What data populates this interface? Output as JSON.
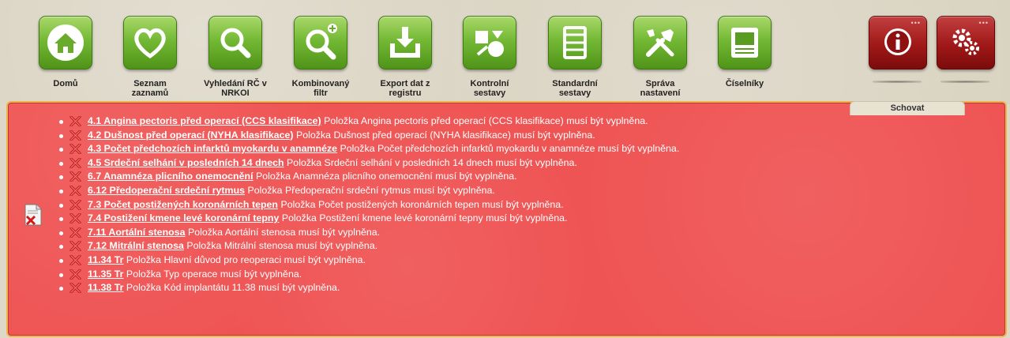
{
  "toolbar": {
    "items": [
      {
        "label": "Domů",
        "icon": "home-icon"
      },
      {
        "label": "Seznam\nzaznamů",
        "icon": "heart-icon"
      },
      {
        "label": "Vyhledání RČ v\nNRKOI",
        "icon": "search-icon"
      },
      {
        "label": "Kombinovaný\nfiltr",
        "icon": "search-plus-icon"
      },
      {
        "label": "Export dat z\nregistru",
        "icon": "download-tray-icon"
      },
      {
        "label": "Kontrolní\nsestavy",
        "icon": "shapes-icon"
      },
      {
        "label": "Standardní\nsestavy",
        "icon": "table-icon"
      },
      {
        "label": "Správa\nnastavení",
        "icon": "tools-icon"
      },
      {
        "label": "Číselníky",
        "icon": "codebook-icon"
      }
    ],
    "right": {
      "info_icon": "info-icon",
      "settings_icon": "gears-icon",
      "dots": "•••"
    }
  },
  "hide_tab": {
    "label": "Schovat"
  },
  "colors": {
    "panel": "#ef5454",
    "tile_green": "#74b935",
    "tile_red": "#a01818"
  },
  "errors": [
    {
      "link": "4.1 Angina pectoris před operací (CCS klasifikace)",
      "message": " Položka Angina pectoris před operací (CCS klasifikace) musí být vyplněna."
    },
    {
      "link": "4.2 Dušnost před operací (NYHA klasifikace)",
      "message": " Položka Dušnost před operací (NYHA klasifikace) musí být vyplněna."
    },
    {
      "link": "4.3 Počet předchozích infarktů myokardu v anamnéze",
      "message": " Položka Počet předchozích infarktů myokardu v anamnéze musí být vyplněna."
    },
    {
      "link": "4.5 Srdeční selhání v posledních 14 dnech",
      "message": " Položka Srdeční selhání v posledních 14 dnech musí být vyplněna."
    },
    {
      "link": "6.7 Anamnéza plicního onemocnění",
      "message": " Položka Anamnéza plicního onemocnění musí být vyplněna."
    },
    {
      "link": "6.12 Předoperační srdeční rytmus",
      "message": " Položka Předoperační srdeční rytmus musí být vyplněna."
    },
    {
      "link": "7.3 Počet postižených koronárních tepen",
      "message": " Položka Počet postižených koronárních tepen musí být vyplněna."
    },
    {
      "link": "7.4 Postižení kmene levé koronární tepny",
      "message": " Položka Postižení kmene levé koronární tepny musí být vyplněna."
    },
    {
      "link": "7.11 Aortální stenosa",
      "message": " Položka Aortální stenosa musí být vyplněna."
    },
    {
      "link": "7.12 Mitrální stenosa",
      "message": " Položka Mitrální stenosa musí být vyplněna."
    },
    {
      "link": "11.34 Tr",
      "message": " Položka Hlavní důvod pro reoperaci musí být vyplněna."
    },
    {
      "link": "11.35 Tr",
      "message": " Položka Typ operace musí být vyplněna."
    },
    {
      "link": "11.38 Tr",
      "message": " Položka Kód implantátu 11.38 musí být vyplněna."
    }
  ]
}
